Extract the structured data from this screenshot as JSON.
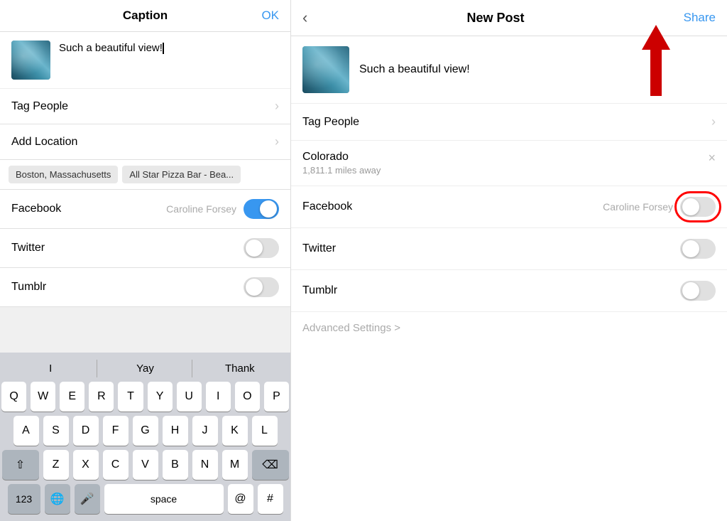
{
  "left": {
    "header": {
      "title": "Caption",
      "ok_label": "OK"
    },
    "caption_text": "Such a beautiful view!",
    "menu": {
      "tag_people": "Tag People",
      "add_location": "Add Location",
      "location_tags": [
        "Boston, Massachusetts",
        "All Star Pizza Bar - Bea..."
      ],
      "facebook_label": "Facebook",
      "facebook_account": "Caroline Forsey",
      "twitter_label": "Twitter",
      "tumblr_label": "Tumblr"
    },
    "keyboard": {
      "suggestions": [
        "I",
        "Yay",
        "Thank"
      ],
      "row1": [
        "Q",
        "W",
        "E",
        "R",
        "T",
        "Y",
        "U",
        "I",
        "O",
        "P"
      ],
      "row2": [
        "A",
        "S",
        "D",
        "F",
        "G",
        "H",
        "J",
        "K",
        "L"
      ],
      "row3": [
        "Z",
        "X",
        "C",
        "V",
        "B",
        "N",
        "M"
      ],
      "bottom": [
        "123",
        "🌐",
        "🎤",
        "space",
        "@",
        "#"
      ]
    }
  },
  "right": {
    "header": {
      "title": "New Post",
      "share_label": "Share"
    },
    "post_caption": "Such a beautiful view!",
    "tag_people": "Tag People",
    "location": {
      "name": "Colorado",
      "distance": "1,811.1 miles away"
    },
    "facebook_label": "Facebook",
    "facebook_account": "Caroline Forsey",
    "twitter_label": "Twitter",
    "tumblr_label": "Tumblr",
    "advanced_settings": "Advanced Settings >"
  }
}
